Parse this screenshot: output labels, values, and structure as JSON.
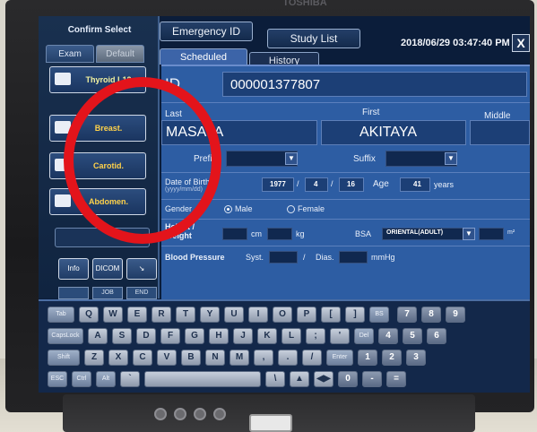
{
  "device": {
    "brand": "TOSHIBA"
  },
  "left_panel": {
    "confirm_select": "Confirm Select",
    "tabs": [
      {
        "label": "Exam"
      },
      {
        "label": "Default"
      }
    ],
    "presets": [
      {
        "label": "Thyroid L12",
        "icon": "thyroid-icon"
      },
      {
        "label": "Breast.",
        "icon": "breast-icon"
      },
      {
        "label": "Carotid.",
        "icon": "carotid-icon"
      },
      {
        "label": "Abdomen.",
        "icon": "abdomen-icon"
      }
    ],
    "dropdown_value": "",
    "buttons": [
      {
        "label": "Info"
      },
      {
        "label": "DICOM"
      },
      {
        "label": ""
      }
    ],
    "under_buttons": [
      {
        "label": ""
      },
      {
        "label": "JOB"
      },
      {
        "label": "END"
      }
    ]
  },
  "header": {
    "top_tabs": [
      {
        "label": "Emergency ID"
      },
      {
        "label": "Study List"
      }
    ],
    "sub_tabs": [
      {
        "label": "Scheduled",
        "active": true
      },
      {
        "label": "History",
        "active": false
      }
    ],
    "datetime": "2018/06/29 03:47:40 PM",
    "close_label": "X"
  },
  "form": {
    "id_label": "ID",
    "id_value": "000001377807",
    "last_label": "Last",
    "first_label": "First",
    "middle_label": "Middle",
    "last_value": "MASAYA",
    "first_value": "AKITAYA",
    "middle_value": "",
    "prefix_label": "Prefix",
    "prefix_value": "",
    "suffix_label": "Suffix",
    "suffix_value": "",
    "dob_label": "Date of Birth",
    "dob_sublabel": "(yyyy/mm/dd)",
    "dob_year": "1977",
    "dob_month": "4",
    "dob_day": "16",
    "age_label": "Age",
    "age_value": "41",
    "age_unit": "years",
    "gender_label": "Gender",
    "gender_options": [
      {
        "label": "Male",
        "selected": true
      },
      {
        "label": "Female",
        "selected": false
      }
    ],
    "height_weight_label_1": "Height /",
    "height_weight_label_2": "Weight",
    "height_value": "",
    "height_unit": "cm",
    "weight_value": "",
    "weight_unit": "kg",
    "bsa_label": "BSA",
    "bsa_method": "ORIENTAL(ADULT)",
    "bsa_value": "",
    "bsa_unit": "m²",
    "bp_label": "Blood Pressure",
    "syst_label": "Syst.",
    "syst_value": "",
    "dias_label": "Dias.",
    "dias_value": "",
    "bp_unit": "mmHg"
  },
  "keyboard": {
    "row1": [
      "Tab",
      "Q",
      "W",
      "E",
      "R",
      "T",
      "Y",
      "U",
      "I",
      "O",
      "P",
      "[",
      "]",
      "BS",
      "7",
      "8",
      "9"
    ],
    "row2": [
      "CapsLock",
      "A",
      "S",
      "D",
      "F",
      "G",
      "H",
      "J",
      "K",
      "L",
      ";",
      "'",
      "Del",
      "4",
      "5",
      "6"
    ],
    "row3": [
      "Shift",
      "Z",
      "X",
      "C",
      "V",
      "B",
      "N",
      "M",
      ",",
      ".",
      "/",
      "Enter",
      "1",
      "2",
      "3"
    ],
    "row4": [
      "ESC",
      "Ctrl",
      "Alt",
      "`",
      "",
      "\\",
      "▲",
      "◀▶",
      "0",
      "-",
      "="
    ]
  },
  "annotation": {
    "color": "#e3141b"
  }
}
